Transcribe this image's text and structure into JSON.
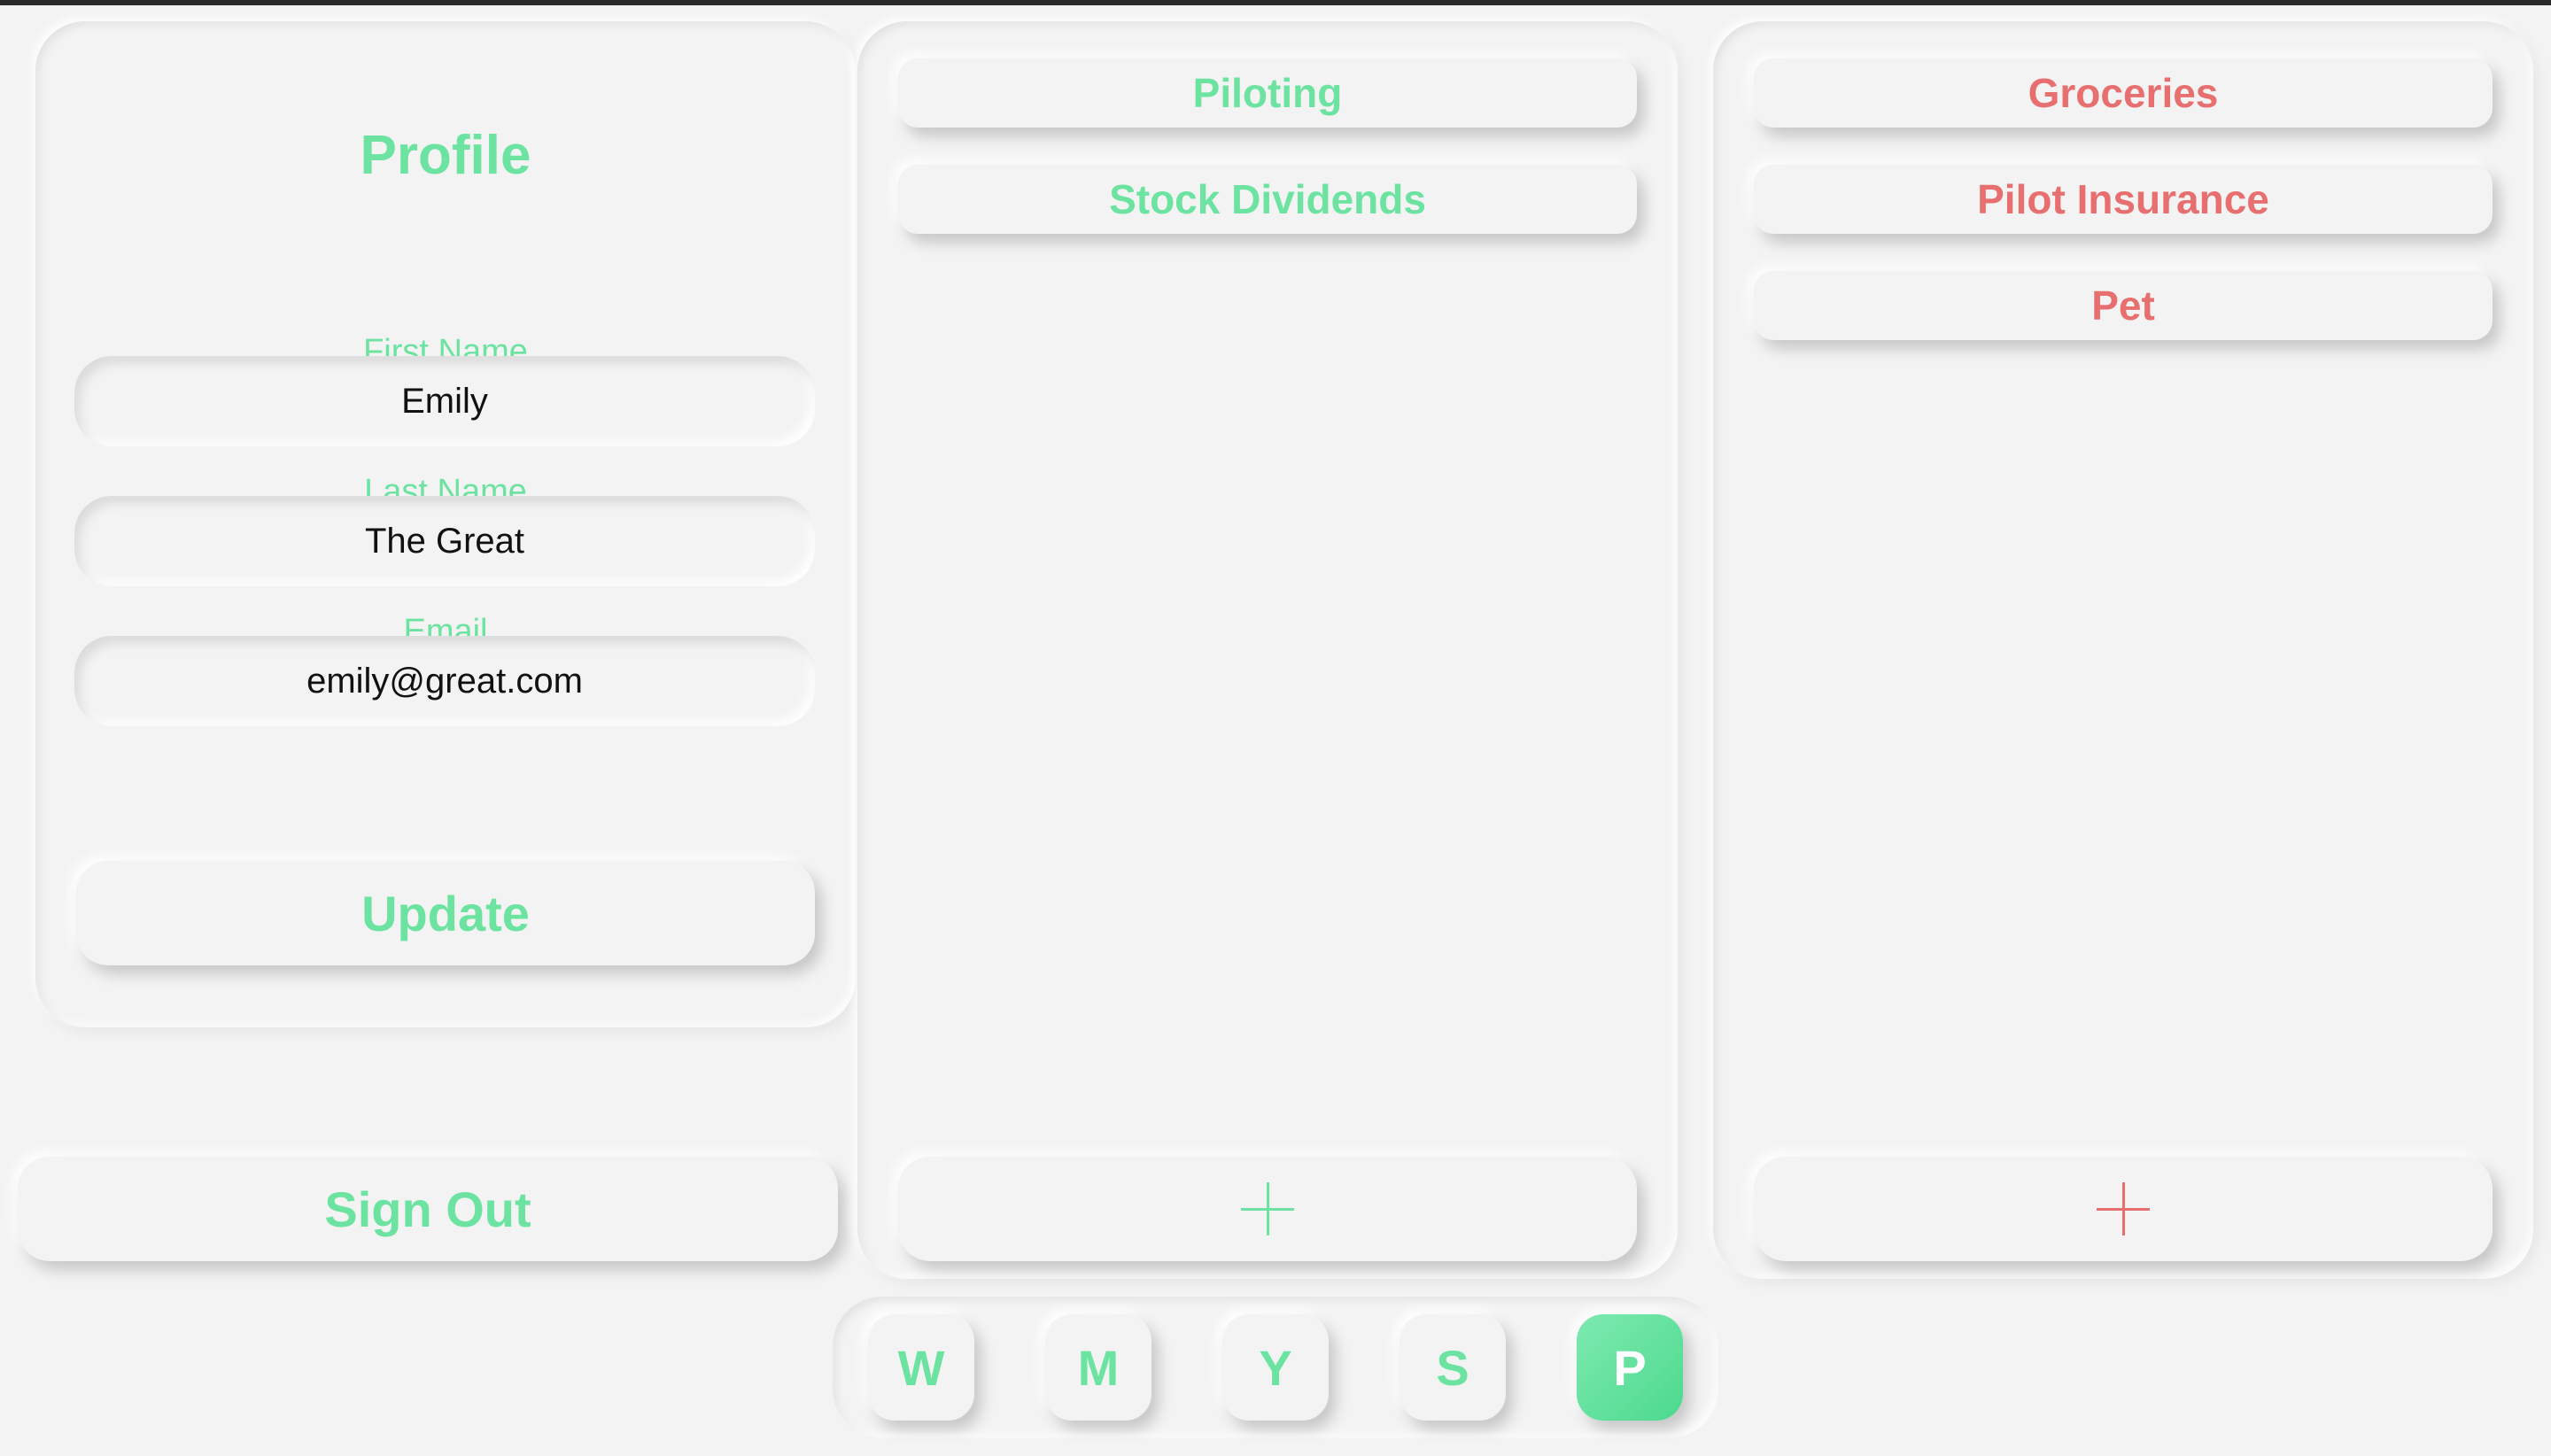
{
  "colors": {
    "accent_green": "#6ce3a0",
    "accent_red": "#e86f6f",
    "background": "#f3f3f3"
  },
  "profile": {
    "title": "Profile",
    "first_name_label": "First Name",
    "first_name_value": "Emily",
    "last_name_label": "Last Name",
    "last_name_value": "The Great",
    "email_label": "Email",
    "email_value": "emily@great.com",
    "update_label": "Update"
  },
  "sign_out_label": "Sign Out",
  "income": {
    "items": [
      "Piloting",
      "Stock Dividends"
    ],
    "add_icon": "plus-icon"
  },
  "expenses": {
    "items": [
      "Groceries",
      "Pilot Insurance",
      "Pet"
    ],
    "add_icon": "plus-icon"
  },
  "nav": {
    "items": [
      {
        "label": "W",
        "active": false
      },
      {
        "label": "M",
        "active": false
      },
      {
        "label": "Y",
        "active": false
      },
      {
        "label": "S",
        "active": false
      },
      {
        "label": "P",
        "active": true
      }
    ]
  }
}
